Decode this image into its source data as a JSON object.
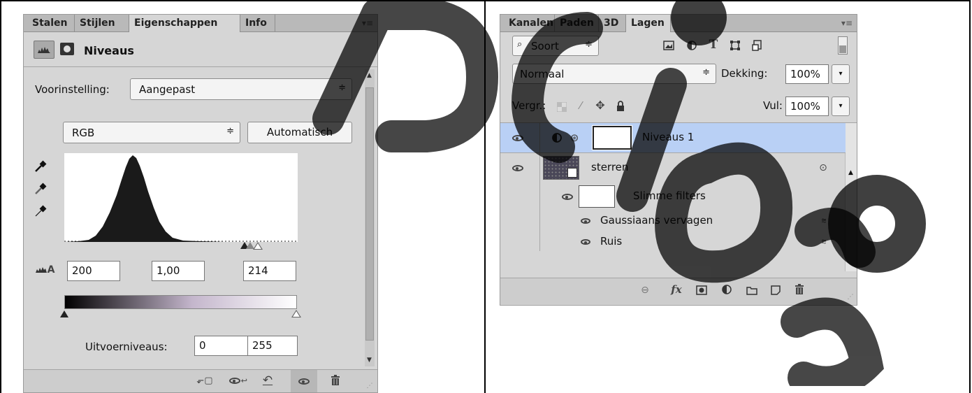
{
  "left_panel": {
    "tabs": [
      "Stalen",
      "Stijlen",
      "Eigenschappen",
      "Info"
    ],
    "active_tab": "Eigenschappen",
    "header_title": "Niveaus",
    "preset_label": "Voorinstelling:",
    "preset_value": "Aangepast",
    "channel_value": "RGB",
    "auto_button": "Automatisch",
    "input_black": "200",
    "input_gamma": "1,00",
    "input_white": "214",
    "output_label": "Uitvoerniveaus:",
    "output_black": "0",
    "output_white": "255",
    "histogram_color": "#1a1a1a"
  },
  "right_panel": {
    "tabs": [
      "Kanalen",
      "Paden",
      "3D",
      "Lagen"
    ],
    "active_tab": "Lagen",
    "filter_kind": "Soort",
    "blend_mode": "Normaal",
    "opacity_label": "Dekking:",
    "opacity_value": "100%",
    "lock_label": "Vergr.:",
    "fill_label": "Vul:",
    "fill_value": "100%",
    "layers": [
      {
        "name": "Niveaus 1",
        "selected": true
      },
      {
        "name": "sterren",
        "selected": false
      }
    ],
    "smart_filters_label": "Slimme filters",
    "filters": [
      "Gaussiaans vervagen",
      "Ruis"
    ],
    "selection_color": "#b9d0f5"
  }
}
